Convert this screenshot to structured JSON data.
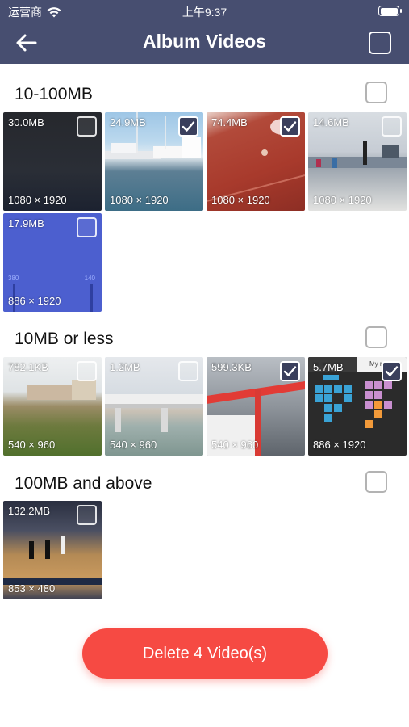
{
  "status_bar": {
    "carrier": "运营商",
    "time": "上午9:37"
  },
  "nav": {
    "title": "Album Videos",
    "back_icon": "arrow-left-icon",
    "select_icon": "checkbox-icon"
  },
  "sections": [
    {
      "title": "10-100MB",
      "items": [
        {
          "size": "30.0MB",
          "resolution": "1080 × 1920",
          "checked": false
        },
        {
          "size": "24.9MB",
          "resolution": "1080 × 1920",
          "checked": true
        },
        {
          "size": "74.4MB",
          "resolution": "1080 × 1920",
          "checked": true
        },
        {
          "size": "14.6MB",
          "resolution": "1080 × 1920",
          "checked": false
        },
        {
          "size": "17.9MB",
          "resolution": "886 × 1920",
          "checked": false
        }
      ]
    },
    {
      "title": "10MB or less",
      "items": [
        {
          "size": "782.1KB",
          "resolution": "540 × 960",
          "checked": false
        },
        {
          "size": "1.2MB",
          "resolution": "540 × 960",
          "checked": false
        },
        {
          "size": "599.3KB",
          "resolution": "540 × 960",
          "checked": true
        },
        {
          "size": "5.7MB",
          "resolution": "886 × 1920",
          "checked": true
        }
      ]
    },
    {
      "title": "100MB and above",
      "items": [
        {
          "size": "132.2MB",
          "resolution": "853 × 480",
          "checked": false
        }
      ]
    }
  ],
  "thumb_extra_text": {
    "num_380": "380",
    "num_140": "140",
    "label_my": "My r"
  },
  "delete_button": {
    "label": "Delete 4 Video(s)"
  },
  "colors": {
    "header": "#474e70",
    "delete": "#f64a43",
    "checked_box": "#3a3f5c"
  }
}
